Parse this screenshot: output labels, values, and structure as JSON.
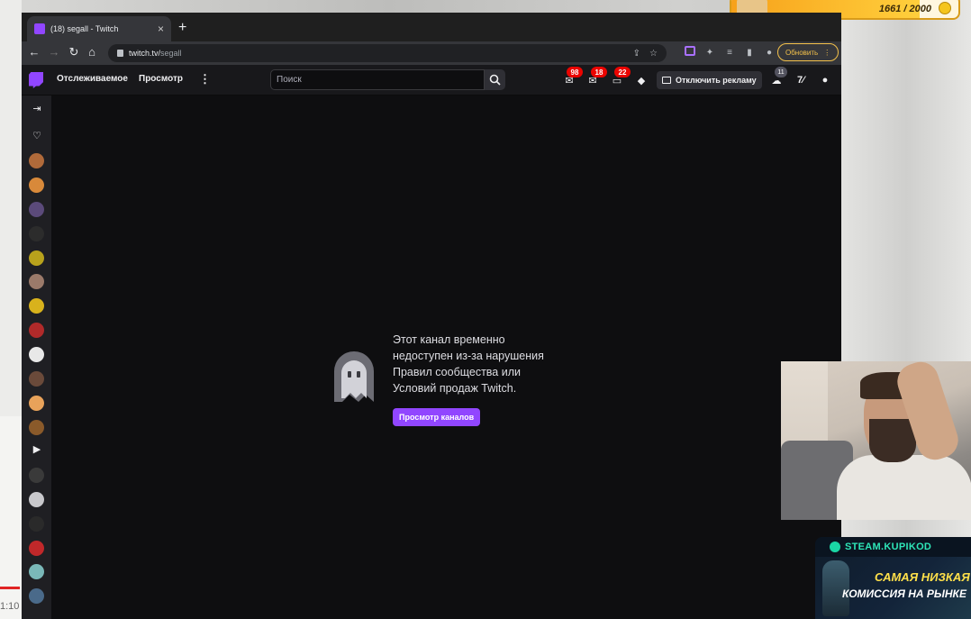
{
  "overlay": {
    "coin_counter": "1661 / 2000",
    "progress": 0.83
  },
  "browser": {
    "tab_title": "(18) segall - Twitch",
    "url_host": "twitch.tv/",
    "url_path": "segall",
    "update_label": "Обновить"
  },
  "topnav": {
    "following": "Отслеживаемое",
    "browse": "Просмотр",
    "search_placeholder": "Поиск",
    "badges": {
      "inbox": "98",
      "whispers": "18",
      "notifications": "22"
    },
    "ad_free_label": "Отключить рекламу",
    "user_badge": "11"
  },
  "main": {
    "message": "Этот канал временно недоступен из-за нарушения Правил сообщества или Условий продаж Twitch.",
    "browse_button": "Просмотр каналов"
  },
  "ad": {
    "brand": "STEAM.KUPIKOD",
    "line1": "САМАЯ НИЗКАЯ",
    "line2": "КОМИССИЯ НА РЫНКЕ"
  },
  "colors": {
    "twitch_purple": "#9146ff",
    "badge_red": "#eb0400",
    "update_yellow": "#f3c14b"
  }
}
